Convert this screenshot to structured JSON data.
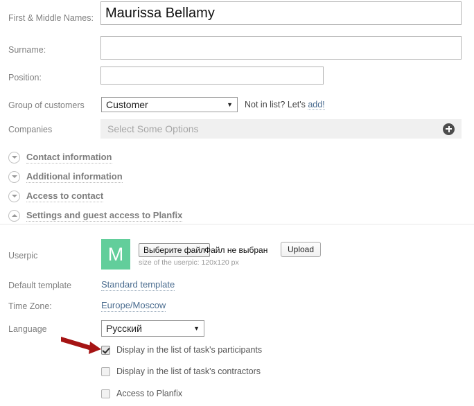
{
  "form": {
    "fields": [
      {
        "label": "First & Middle Names:",
        "value": "Maurissa Bellamy",
        "placeholder": ""
      },
      {
        "label": "Surname:",
        "value": "",
        "placeholder": ""
      },
      {
        "label": "Position:",
        "value": "",
        "placeholder": ""
      }
    ],
    "group_of_customers": {
      "label": "Group of customers",
      "selected": "Customer",
      "caret": "▼",
      "not_in_list_text": "Not in list? Let's",
      "add_link": "add!"
    },
    "companies": {
      "label": "Companies",
      "placeholder": "Select Some Options",
      "add_icon": "plus-circle-icon"
    }
  },
  "accordion": [
    {
      "label": "Contact information",
      "state": "collapsed",
      "icon": "chevron-down-icon"
    },
    {
      "label": "Additional information",
      "state": "collapsed",
      "icon": "chevron-down-icon"
    },
    {
      "label": "Access to contact",
      "state": "collapsed",
      "icon": "chevron-down-icon"
    },
    {
      "label": "Settings and guest access to Planfix",
      "state": "expanded",
      "icon": "chevron-up-icon"
    }
  ],
  "settings": {
    "userpic": {
      "label": "Userpic",
      "avatar_initial": "M",
      "avatar_color": "#62ce9b",
      "choose_file_button": "Выберите файл",
      "file_status": "Файл не выбран",
      "upload_button": "Upload",
      "hint": "size of the userpic: 120x120 px"
    },
    "default_template": {
      "label": "Default template",
      "value": "Standard template"
    },
    "time_zone": {
      "label": "Time Zone:",
      "value": "Europe/Moscow"
    },
    "language": {
      "label": "Language",
      "selected": "Русский",
      "caret": "▼"
    },
    "checkboxes": [
      {
        "label": "Display in the list of task's participants",
        "checked": true
      },
      {
        "label": "Display in the list of task's contractors",
        "checked": false
      },
      {
        "label": "Access to Planfix",
        "checked": false
      }
    ]
  },
  "annotation": {
    "arrow_color": "#a51414",
    "points_to": "Display in the list of task's participants"
  }
}
